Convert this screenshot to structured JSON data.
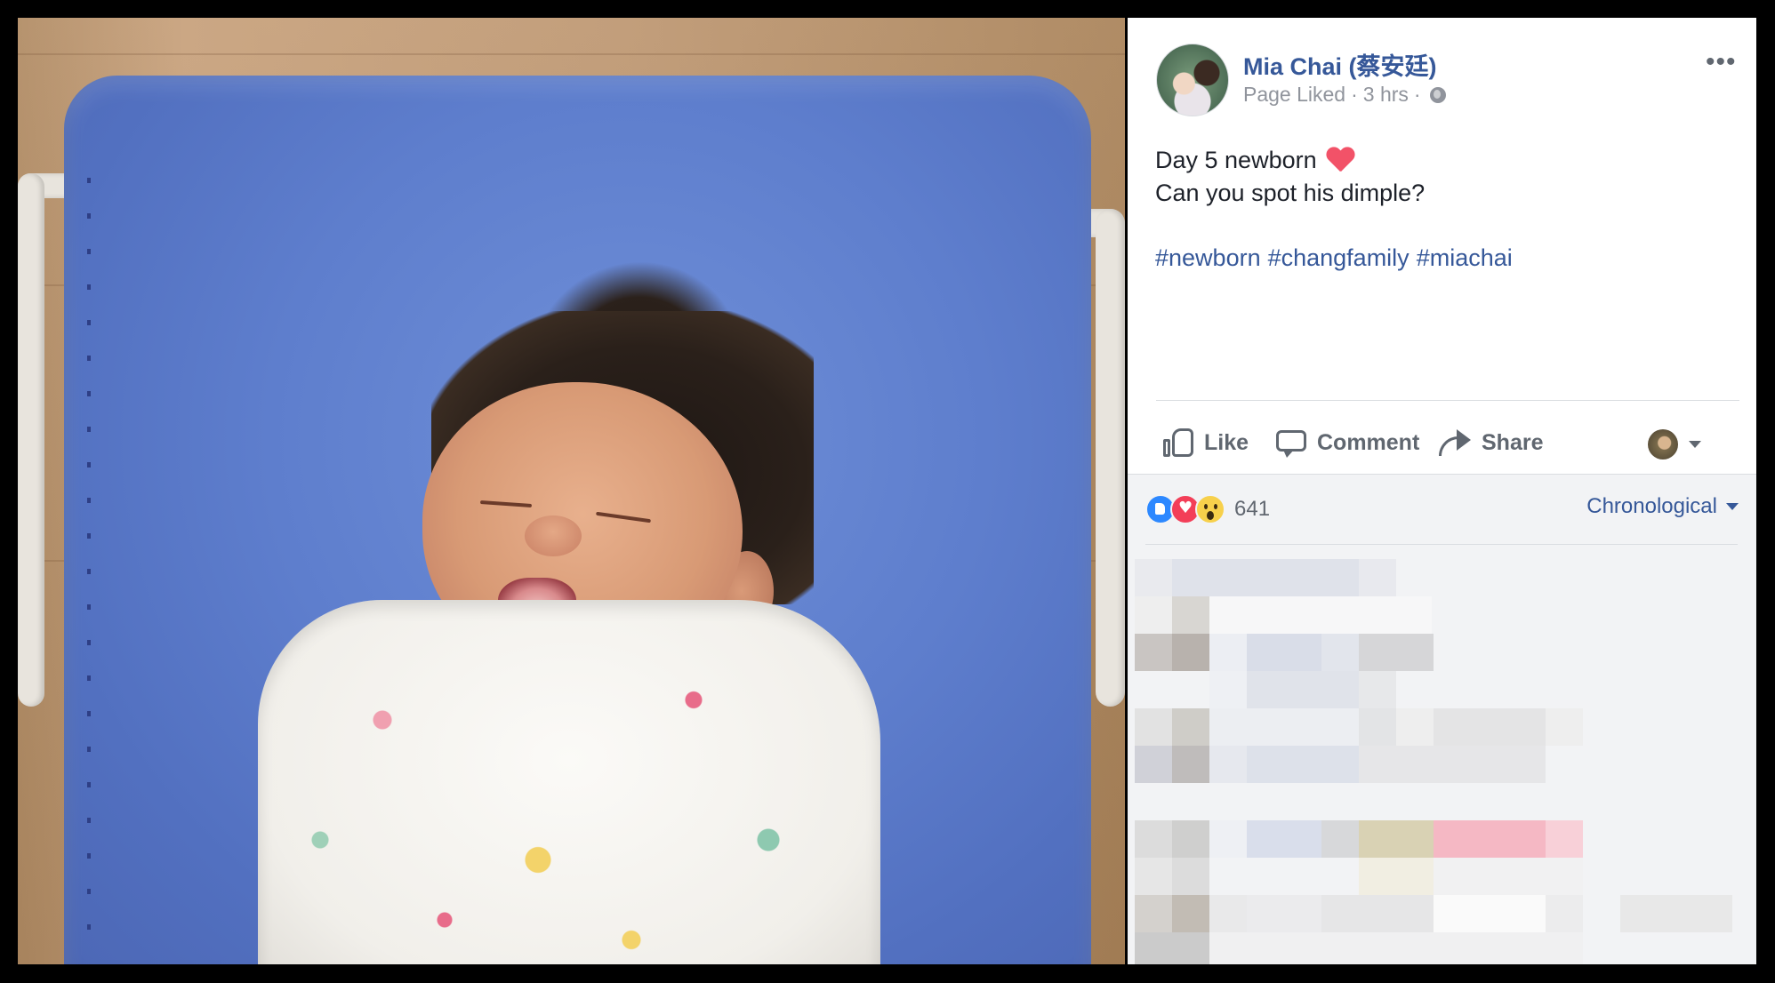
{
  "post": {
    "author": "Mia Chai (蔡安廷)",
    "meta_action": "Page Liked",
    "separator": "·",
    "time": "3 hrs",
    "separator2": "·",
    "more_label": "•••",
    "text_line1": "Day 5 newborn",
    "text_line2": "Can you spot his dimple?",
    "hashtags": [
      "#newborn",
      "#changfamily",
      "#miachai"
    ]
  },
  "actions": {
    "like": "Like",
    "comment": "Comment",
    "share": "Share"
  },
  "reactions": {
    "count": "641",
    "types": [
      "like-icon",
      "love-icon",
      "wow-icon"
    ]
  },
  "comments": {
    "sort_label": "Chronological"
  },
  "colors": {
    "link": "#365899",
    "text": "#1d2129",
    "muted": "#90949c",
    "action": "#606770",
    "panel_bg": "#ffffff",
    "comments_bg": "#f2f3f5"
  }
}
